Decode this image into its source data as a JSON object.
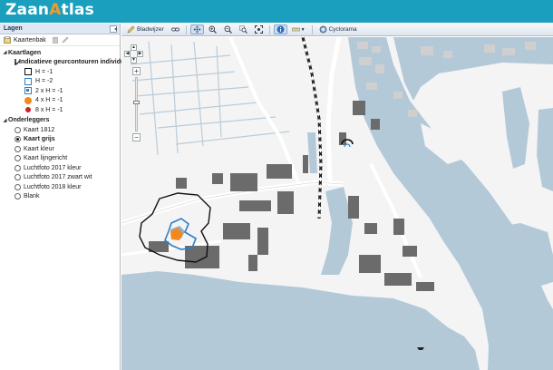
{
  "app": {
    "logo_part1": "Zaan",
    "logo_accent": "A",
    "logo_part2": "tlas",
    "header_color": "#1a9fbe",
    "accent_color": "#f39a2a"
  },
  "layers_panel": {
    "title": "Lagen",
    "toolbar": {
      "kaartenbak_label": "Kaartenbak"
    },
    "kaartlagen": {
      "title": "Kaartlagen",
      "group_label": "Indicatieve geurcontouren individuele",
      "items": [
        {
          "label": "H = -1",
          "symbol": "square",
          "color": "#111111"
        },
        {
          "label": "H = -2",
          "symbol": "square",
          "color": "#2f7ec4"
        },
        {
          "label": "2 x H = -1",
          "symbol": "square-filled",
          "color": "#2f7ec4"
        },
        {
          "label": "4 x H = -1",
          "symbol": "dot",
          "color": "#f08a1c"
        },
        {
          "label": "8 x H = -1",
          "symbol": "dot",
          "color": "#d22020"
        }
      ]
    },
    "onderleggers": {
      "title": "Onderleggers",
      "items": [
        {
          "label": "Kaart 1812",
          "selected": false
        },
        {
          "label": "Kaart grijs",
          "selected": true
        },
        {
          "label": "Kaart kleur",
          "selected": false
        },
        {
          "label": "Kaart lijngericht",
          "selected": false
        },
        {
          "label": "Luchtfoto 2017 kleur",
          "selected": false
        },
        {
          "label": "Luchtfoto 2017 zwart wit",
          "selected": false
        },
        {
          "label": "Luchtfoto 2018 kleur",
          "selected": false
        },
        {
          "label": "Blank",
          "selected": false
        }
      ]
    }
  },
  "map_toolbar": {
    "bladwijzer_label": "Bladwijzer",
    "cyclorama_label": "Cyclorama"
  },
  "map": {
    "water_color": "#b4c9d8",
    "building_color": "#6b6b6b"
  }
}
